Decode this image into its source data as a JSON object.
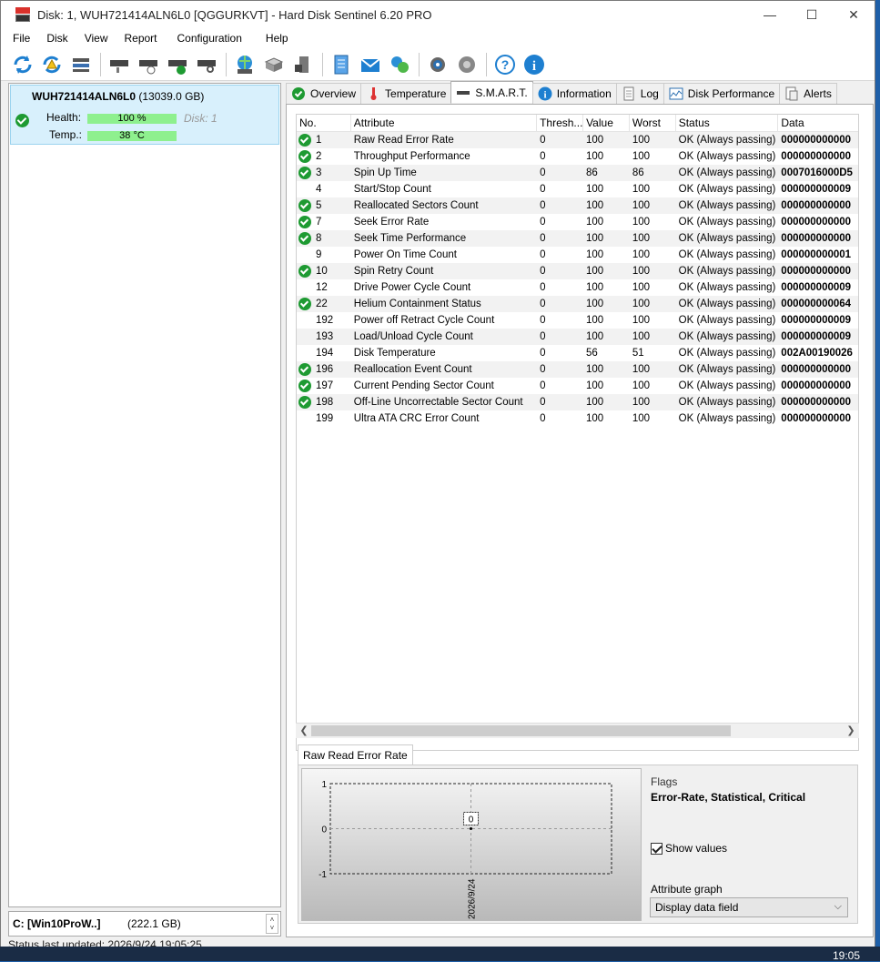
{
  "window": {
    "title": "Disk: 1, WUH721414ALN6L0 [QGGURKVT]  -  Hard Disk Sentinel 6.20 PRO",
    "minimize": "—",
    "maximize": "☐",
    "close": "✕"
  },
  "menu": [
    "File",
    "Disk",
    "View",
    "Report",
    "Configuration",
    "Help"
  ],
  "toolbar_icons": [
    "refresh-icon",
    "refresh-warning-icon",
    "disk-list-icon",
    "disk-test-icon",
    "disk-schedule-icon",
    "disk-check-icon",
    "disk-search-icon",
    "globe-drive-icon",
    "drive-config-icon",
    "drive-usb-icon",
    "notepad-icon",
    "mail-icon",
    "network-icon",
    "settings-icon",
    "sound-icon",
    "help-icon",
    "info-icon"
  ],
  "disk_card": {
    "name": "WUH721414ALN6L0",
    "size": "(13039.0 GB)",
    "health_label": "Health:",
    "health_value": "100 %",
    "health_level": 1.0,
    "disk_index": "Disk: 1",
    "temp_label": "Temp.:",
    "temp_value": "38 °C"
  },
  "volume": {
    "name": "C: [Win10ProW..]",
    "size": "(222.1 GB)"
  },
  "status_text": "Status last updated: 2026/9/24 19:05:25",
  "tabs": [
    "Overview",
    "Temperature",
    "S.M.A.R.T.",
    "Information",
    "Log",
    "Disk Performance",
    "Alerts"
  ],
  "smart": {
    "columns": [
      "No.",
      "Attribute",
      "Thresh...",
      "Value",
      "Worst",
      "Status",
      "Data"
    ],
    "rows": [
      {
        "ok": true,
        "no": "1",
        "attr": "Raw Read Error Rate",
        "thresh": "0",
        "value": "100",
        "worst": "100",
        "status": "OK (Always passing)",
        "data": "000000000000"
      },
      {
        "ok": true,
        "no": "2",
        "attr": "Throughput Performance",
        "thresh": "0",
        "value": "100",
        "worst": "100",
        "status": "OK (Always passing)",
        "data": "000000000000"
      },
      {
        "ok": true,
        "no": "3",
        "attr": "Spin Up Time",
        "thresh": "0",
        "value": "86",
        "worst": "86",
        "status": "OK (Always passing)",
        "data": "0007016000D5"
      },
      {
        "ok": false,
        "no": "4",
        "attr": "Start/Stop Count",
        "thresh": "0",
        "value": "100",
        "worst": "100",
        "status": "OK (Always passing)",
        "data": "000000000009"
      },
      {
        "ok": true,
        "no": "5",
        "attr": "Reallocated Sectors Count",
        "thresh": "0",
        "value": "100",
        "worst": "100",
        "status": "OK (Always passing)",
        "data": "000000000000"
      },
      {
        "ok": true,
        "no": "7",
        "attr": "Seek Error Rate",
        "thresh": "0",
        "value": "100",
        "worst": "100",
        "status": "OK (Always passing)",
        "data": "000000000000"
      },
      {
        "ok": true,
        "no": "8",
        "attr": "Seek Time Performance",
        "thresh": "0",
        "value": "100",
        "worst": "100",
        "status": "OK (Always passing)",
        "data": "000000000000"
      },
      {
        "ok": false,
        "no": "9",
        "attr": "Power On Time Count",
        "thresh": "0",
        "value": "100",
        "worst": "100",
        "status": "OK (Always passing)",
        "data": "000000000001"
      },
      {
        "ok": true,
        "no": "10",
        "attr": "Spin Retry Count",
        "thresh": "0",
        "value": "100",
        "worst": "100",
        "status": "OK (Always passing)",
        "data": "000000000000"
      },
      {
        "ok": false,
        "no": "12",
        "attr": "Drive Power Cycle Count",
        "thresh": "0",
        "value": "100",
        "worst": "100",
        "status": "OK (Always passing)",
        "data": "000000000009"
      },
      {
        "ok": true,
        "no": "22",
        "attr": "Helium Containment Status",
        "thresh": "0",
        "value": "100",
        "worst": "100",
        "status": "OK (Always passing)",
        "data": "000000000064"
      },
      {
        "ok": false,
        "no": "192",
        "attr": "Power off Retract Cycle Count",
        "thresh": "0",
        "value": "100",
        "worst": "100",
        "status": "OK (Always passing)",
        "data": "000000000009"
      },
      {
        "ok": false,
        "no": "193",
        "attr": "Load/Unload Cycle Count",
        "thresh": "0",
        "value": "100",
        "worst": "100",
        "status": "OK (Always passing)",
        "data": "000000000009"
      },
      {
        "ok": false,
        "no": "194",
        "attr": "Disk Temperature",
        "thresh": "0",
        "value": "56",
        "worst": "51",
        "status": "OK (Always passing)",
        "data": "002A00190026"
      },
      {
        "ok": true,
        "no": "196",
        "attr": "Reallocation Event Count",
        "thresh": "0",
        "value": "100",
        "worst": "100",
        "status": "OK (Always passing)",
        "data": "000000000000"
      },
      {
        "ok": true,
        "no": "197",
        "attr": "Current Pending Sector Count",
        "thresh": "0",
        "value": "100",
        "worst": "100",
        "status": "OK (Always passing)",
        "data": "000000000000"
      },
      {
        "ok": true,
        "no": "198",
        "attr": "Off-Line Uncorrectable Sector Count",
        "thresh": "0",
        "value": "100",
        "worst": "100",
        "status": "OK (Always passing)",
        "data": "000000000000"
      },
      {
        "ok": false,
        "no": "199",
        "attr": "Ultra ATA CRC Error Count",
        "thresh": "0",
        "value": "100",
        "worst": "100",
        "status": "OK (Always passing)",
        "data": "000000000000"
      }
    ]
  },
  "detail": {
    "tab_label": "Raw Read Error Rate",
    "flags_label": "Flags",
    "flags_value": "Error-Rate, Statistical, Critical",
    "show_values_label": "Show values",
    "show_values_checked": true,
    "attr_graph_label": "Attribute graph",
    "attr_graph_value": "Display data field"
  },
  "chart_data": {
    "type": "line",
    "x": [
      "2026/9/24"
    ],
    "series": [
      {
        "values": [
          0
        ]
      }
    ],
    "ylim": [
      -1,
      1
    ],
    "yticks": [
      "1",
      "0",
      "-1"
    ],
    "value_labels": [
      "0"
    ]
  },
  "taskbar": {
    "clock": "19:05"
  }
}
